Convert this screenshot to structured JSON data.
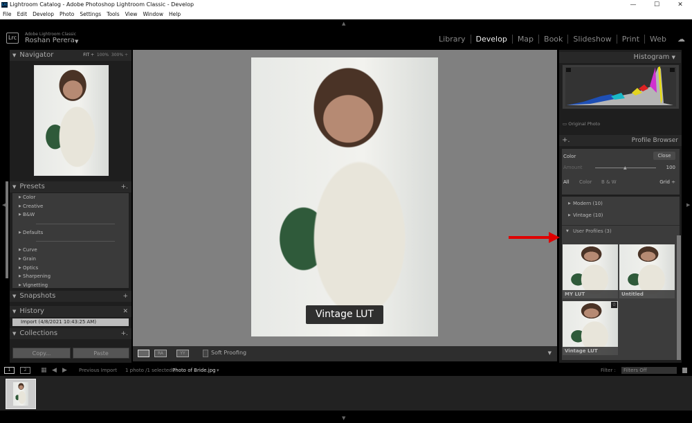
{
  "window": {
    "title": "Lightroom Catalog - Adobe Photoshop Lightroom Classic - Develop",
    "app_badge": "Lrc",
    "controls": [
      "—",
      "☐",
      "✕"
    ]
  },
  "menu": [
    "File",
    "Edit",
    "Develop",
    "Photo",
    "Settings",
    "Tools",
    "View",
    "Window",
    "Help"
  ],
  "identity": {
    "logo": "Lrc",
    "product": "Adobe Lightroom Classic",
    "user": "Roshan Perera"
  },
  "modules": [
    {
      "label": "Library",
      "active": false
    },
    {
      "label": "Develop",
      "active": true
    },
    {
      "label": "Map",
      "active": false
    },
    {
      "label": "Book",
      "active": false
    },
    {
      "label": "Slideshow",
      "active": false
    },
    {
      "label": "Print",
      "active": false
    },
    {
      "label": "Web",
      "active": false
    }
  ],
  "left": {
    "navigator": {
      "title": "Navigator",
      "zoom": [
        "FIT ÷",
        "100%",
        "300% ÷"
      ]
    },
    "presets": {
      "title": "Presets",
      "groups1": [
        "Color",
        "Creative",
        "B&W"
      ],
      "groups2": [
        "Defaults"
      ],
      "groups3": [
        "Curve",
        "Grain",
        "Optics",
        "Sharpening",
        "Vignetting"
      ]
    },
    "snapshots": {
      "title": "Snapshots"
    },
    "history": {
      "title": "History",
      "items": [
        "Import (4/8/2021 10:43:25 AM)"
      ]
    },
    "collections": {
      "title": "Collections"
    },
    "copy": "Copy...",
    "paste": "Paste"
  },
  "center": {
    "overlay": "Vintage LUT",
    "soft_proofing": "Soft Proofing",
    "soft_proofing_checked": false
  },
  "right": {
    "histogram": {
      "title": "Histogram",
      "original_photo": "Original Photo"
    },
    "profile_browser": {
      "title": "Profile Browser",
      "group": "Color",
      "close": "Close",
      "amount_label": "Amount",
      "amount": "100",
      "amount_value": 100,
      "filters": [
        "All",
        "Color",
        "B & W"
      ],
      "view": "Grid ÷",
      "categories": [
        "Modern (10)",
        "Vintage (10)"
      ],
      "user_profiles": "User Profiles (3)",
      "profiles": [
        {
          "name": "MY LUT"
        },
        {
          "name": "Untitled"
        },
        {
          "name": "Vintage LUT",
          "favorite": true
        }
      ]
    }
  },
  "filmstrip": {
    "source": "Previous Import",
    "count": "1 photo /1 selected /",
    "file": "Photo of Bride.jpg",
    "filter_label": "Filter :",
    "filter_value": "Filters Off",
    "pages": [
      "1",
      "2"
    ]
  },
  "colors": {
    "accent_arrow": "#e00000",
    "panel": "#282828",
    "canvas": "#808080"
  }
}
